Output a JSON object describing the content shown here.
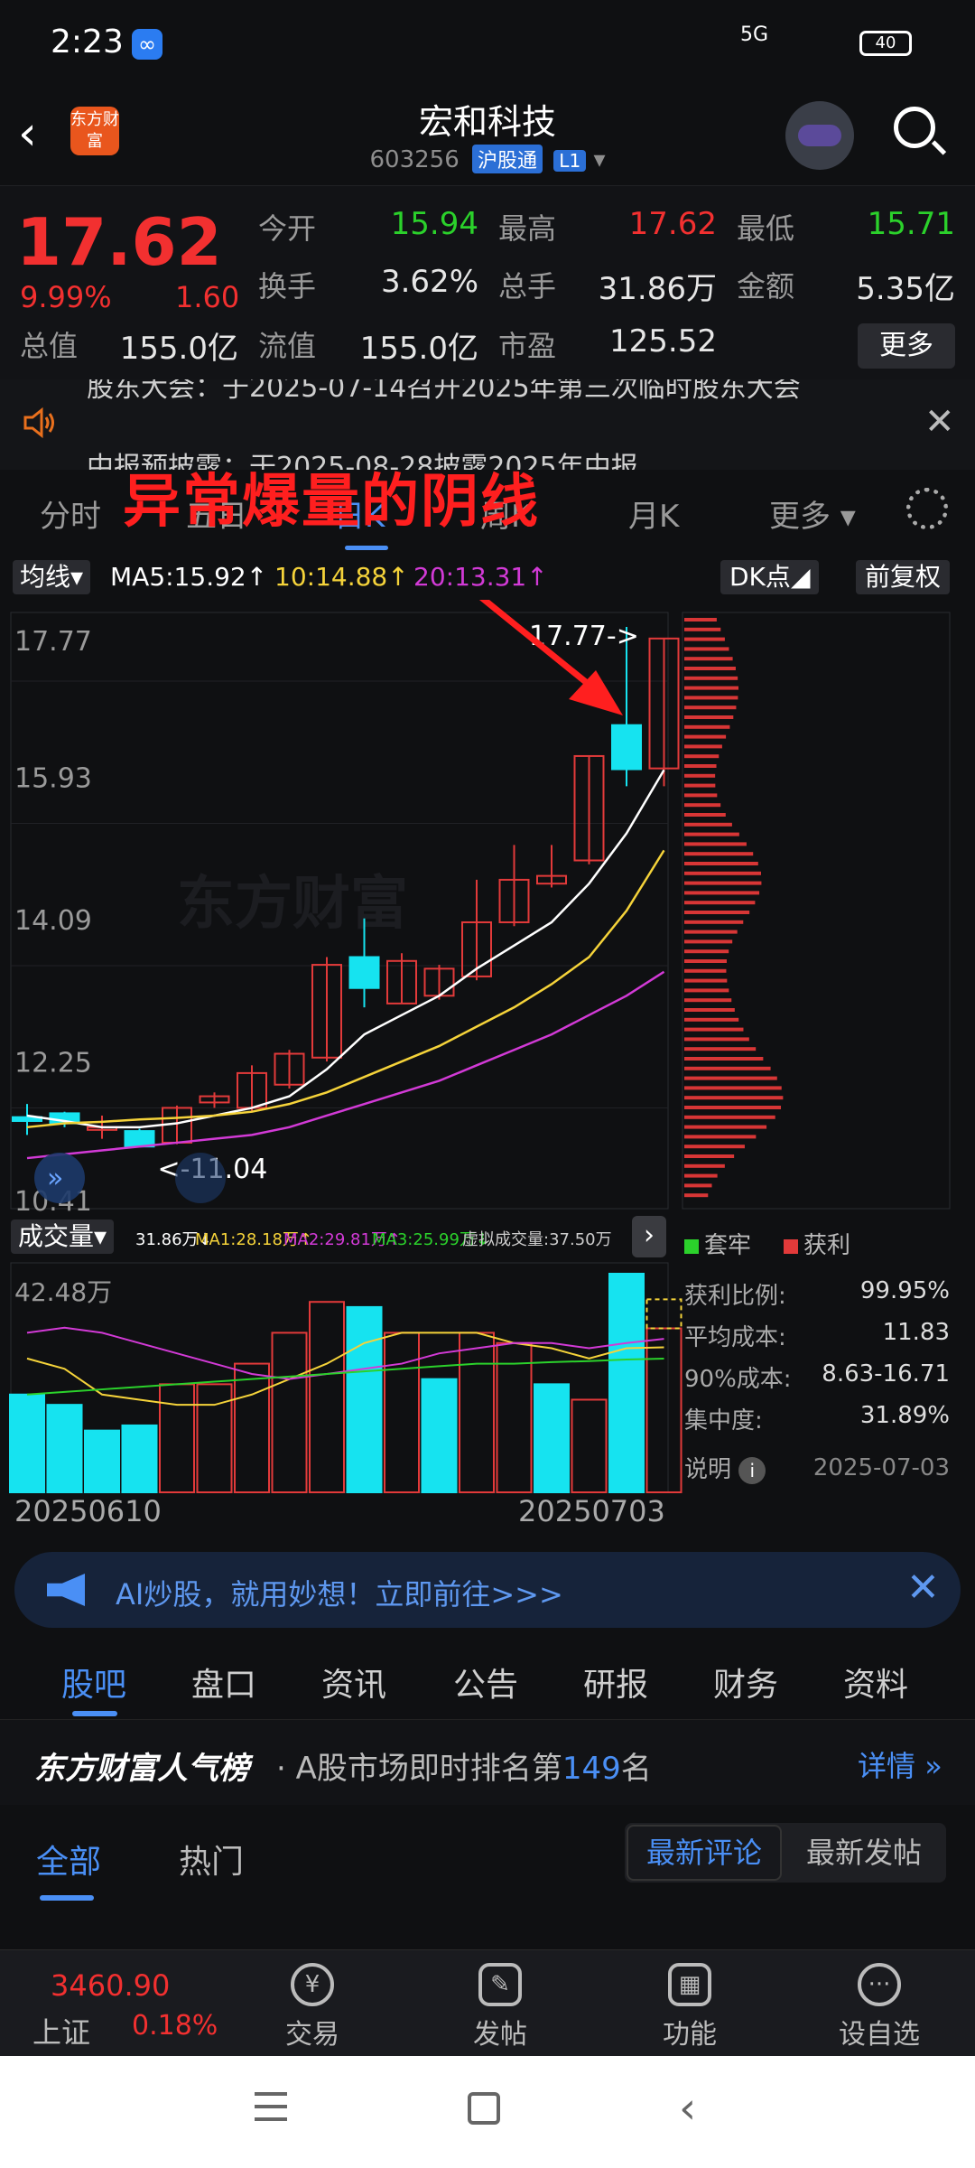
{
  "status": {
    "time": "2:23",
    "network": "5G",
    "battery": "40"
  },
  "header": {
    "title": "宏和科技",
    "code": "603256",
    "badge": "沪股通",
    "level": "L1",
    "logo_text": "东方财富"
  },
  "quote": {
    "price": "17.62",
    "change_pct": "9.99%",
    "change": "1.60",
    "rows": [
      [
        {
          "label": "今开",
          "value": "15.94",
          "color": "green"
        },
        {
          "label": "最高",
          "value": "17.62",
          "color": "red"
        },
        {
          "label": "最低",
          "value": "15.71",
          "color": "green"
        }
      ],
      [
        {
          "label": "换手",
          "value": "3.62%",
          "color": ""
        },
        {
          "label": "总手",
          "value": "31.86万",
          "color": ""
        },
        {
          "label": "金额",
          "value": "5.35亿",
          "color": ""
        }
      ],
      [
        {
          "label": "总值",
          "value": "155.0亿",
          "color": ""
        },
        {
          "label": "流值",
          "value": "155.0亿",
          "color": ""
        },
        {
          "label": "市盈",
          "value": "125.52",
          "color": ""
        }
      ]
    ],
    "more": "更多"
  },
  "announcement": {
    "line1": "股东大会：于2025-07-14召开2025年第三次临时股东大会",
    "line2": "中报预披露：于2025-08-28披露2025年中报"
  },
  "period_tabs": [
    "分时",
    "五日",
    "日K",
    "周K",
    "月K",
    "更多"
  ],
  "active_period": 2,
  "annotation": "异常爆量的阴线",
  "ma": {
    "selector": "均线",
    "ma5": "MA5:15.92",
    "ma10": "10:14.88",
    "ma20": "20:13.31",
    "dk": "DK点",
    "fq": "前复权"
  },
  "chart_data": {
    "type": "candlestick",
    "y_ticks": [
      "17.77",
      "15.93",
      "14.09",
      "12.25",
      "10.41"
    ],
    "ylim": [
      10.41,
      17.77
    ],
    "high_label": "17.77->",
    "low_label": "<-11.04",
    "watermark": "东方财富",
    "candles": [
      {
        "o": 11.43,
        "c": 11.38,
        "h": 11.6,
        "l": 11.2
      },
      {
        "o": 11.48,
        "c": 11.35,
        "h": 11.5,
        "l": 11.3
      },
      {
        "o": 11.3,
        "c": 11.3,
        "h": 11.45,
        "l": 11.15
      },
      {
        "o": 11.25,
        "c": 11.05,
        "h": 11.28,
        "l": 11.04
      },
      {
        "o": 11.1,
        "c": 11.55,
        "h": 11.58,
        "l": 11.08
      },
      {
        "o": 11.62,
        "c": 11.7,
        "h": 11.75,
        "l": 11.55
      },
      {
        "o": 11.55,
        "c": 12.0,
        "h": 12.1,
        "l": 11.5
      },
      {
        "o": 11.85,
        "c": 12.25,
        "h": 12.3,
        "l": 11.8
      },
      {
        "o": 12.2,
        "c": 13.4,
        "h": 13.5,
        "l": 12.15
      },
      {
        "o": 13.5,
        "c": 13.1,
        "h": 14.0,
        "l": 12.85
      },
      {
        "o": 12.9,
        "c": 13.45,
        "h": 13.55,
        "l": 12.9
      },
      {
        "o": 13.0,
        "c": 13.35,
        "h": 13.4,
        "l": 12.95
      },
      {
        "o": 13.25,
        "c": 13.95,
        "h": 14.5,
        "l": 13.2
      },
      {
        "o": 13.95,
        "c": 14.5,
        "h": 14.95,
        "l": 13.9
      },
      {
        "o": 14.45,
        "c": 14.55,
        "h": 14.95,
        "l": 14.4
      },
      {
        "o": 14.75,
        "c": 16.1,
        "h": 16.1,
        "l": 14.7
      },
      {
        "o": 16.5,
        "c": 15.93,
        "h": 17.77,
        "l": 15.71
      },
      {
        "o": 15.94,
        "c": 17.62,
        "h": 17.62,
        "l": 15.71
      }
    ],
    "ma5": [
      11.45,
      11.38,
      11.3,
      11.3,
      11.35,
      11.45,
      11.55,
      11.7,
      12.05,
      12.5,
      12.75,
      13.0,
      13.35,
      13.65,
      13.95,
      14.45,
      15.1,
      15.92
    ],
    "ma10": [
      11.3,
      11.35,
      11.37,
      11.4,
      11.42,
      11.45,
      11.5,
      11.6,
      11.75,
      11.95,
      12.15,
      12.35,
      12.6,
      12.85,
      13.15,
      13.5,
      14.1,
      14.88
    ],
    "ma20": [
      10.9,
      10.95,
      11.0,
      11.05,
      11.1,
      11.15,
      11.2,
      11.3,
      11.45,
      11.6,
      11.75,
      11.9,
      12.1,
      12.3,
      12.5,
      12.75,
      13.0,
      13.31
    ],
    "volume": {
      "top_label": "42.48万",
      "bars": [
        {
          "v": 19,
          "up": false
        },
        {
          "v": 17,
          "up": false
        },
        {
          "v": 12,
          "up": false
        },
        {
          "v": 13,
          "up": false
        },
        {
          "v": 21,
          "up": true
        },
        {
          "v": 21,
          "up": true
        },
        {
          "v": 25,
          "up": true
        },
        {
          "v": 31,
          "up": true
        },
        {
          "v": 37,
          "up": true
        },
        {
          "v": 36,
          "up": false
        },
        {
          "v": 31,
          "up": true
        },
        {
          "v": 22,
          "up": false
        },
        {
          "v": 31,
          "up": true
        },
        {
          "v": 29,
          "up": true
        },
        {
          "v": 21,
          "up": false
        },
        {
          "v": 18,
          "up": true
        },
        {
          "v": 42.48,
          "up": false
        },
        {
          "v": 31.86,
          "up": true
        }
      ],
      "virtual": 37.5,
      "ma1": [
        26,
        24,
        19,
        18,
        17,
        17,
        19,
        22,
        25,
        29,
        31,
        31,
        31,
        29,
        28,
        26,
        28,
        28.18
      ],
      "ma2": [
        31,
        32,
        31,
        29,
        27,
        25,
        23,
        22,
        23,
        24,
        25,
        27,
        28,
        29,
        29,
        28,
        29,
        29.81
      ],
      "ma3": [
        19,
        19.5,
        20,
        20.5,
        21,
        21.5,
        22,
        22.5,
        23,
        23.5,
        24,
        24.5,
        25,
        25,
        25.3,
        25.5,
        25.8,
        25.99
      ]
    },
    "vol_labels": {
      "selector": "成交量",
      "total": "31.86万",
      "ma1": "MA1:28.18万",
      "ma2": "MA2:29.81万",
      "ma3": "MA3:25.99万",
      "virtual": "虚拟成交量:37.50万"
    },
    "dates": [
      "20250610",
      "20250703"
    ]
  },
  "chip": {
    "legend_locked": "套牢",
    "legend_profit": "获利",
    "stats": [
      {
        "label": "获利比例:",
        "value": "99.95%"
      },
      {
        "label": "平均成本:",
        "value": "11.83"
      },
      {
        "label": "90%成本:",
        "value": "8.63-16.71"
      },
      {
        "label": "集中度:",
        "value": "31.89%"
      }
    ],
    "note": "说明",
    "date": "2025-07-03"
  },
  "ad": {
    "text": "AI炒股，就用妙想！立即前往>>>"
  },
  "section_tabs": [
    "股吧",
    "盘口",
    "资讯",
    "公告",
    "研报",
    "财务",
    "资料"
  ],
  "rank": {
    "brand": "东方财富人气榜",
    "desc_prefix": "· A股市场即时排名第",
    "num": "149",
    "desc_suffix": "名",
    "detail": "详情"
  },
  "feed_tabs": [
    "全部",
    "热门"
  ],
  "feed_sort": [
    "最新评论",
    "最新发帖"
  ],
  "bottom": {
    "index_value": "3460.90",
    "index_name": "上证",
    "index_pct": "0.18%",
    "items": [
      "交易",
      "发帖",
      "功能",
      "设自选"
    ]
  }
}
